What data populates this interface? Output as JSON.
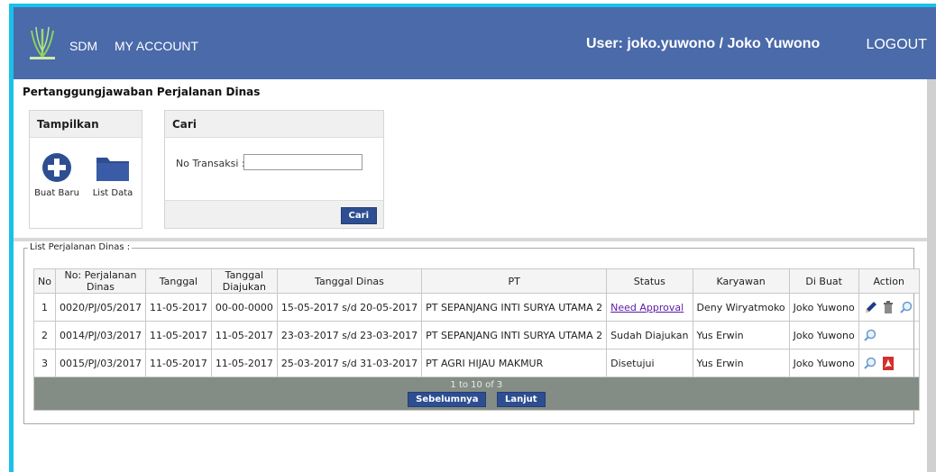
{
  "nav": {
    "app_name": "SDM",
    "account_label": "MY ACCOUNT",
    "user_label": "User: joko.yuwono / Joko Yuwono",
    "logout_label": "LOGOUT",
    "bar_color": "#4a6aa9"
  },
  "page_title": "Pertanggungjawaban Perjalanan Dinas",
  "tampilkan": {
    "title": "Tampilkan",
    "new_label": "Buat Baru",
    "list_label": "List Data",
    "icons": [
      "plus-circle-icon",
      "folder-icon"
    ]
  },
  "search": {
    "title": "Cari",
    "field_label": "No Transaksi :",
    "field_value": "",
    "button_label": "Cari"
  },
  "list": {
    "legend": "List Perjalanan Dinas :",
    "columns": [
      "No",
      "No: Perjalanan Dinas",
      "Tanggal",
      "Tanggal Diajukan",
      "Tanggal Dinas",
      "PT",
      "Status",
      "Karyawan",
      "Di Buat",
      "Action"
    ],
    "rows": [
      {
        "no": "1",
        "id": "0020/PJ/05/2017",
        "tanggal": "11-05-2017",
        "diajukan": "00-00-0000",
        "dinas": "15-05-2017 s/d 20-05-2017",
        "pt": "PT SEPANJANG INTI SURYA UTAMA 2",
        "status": "Need Approval",
        "karyawan": "Deny Wiryatmoko",
        "dibuat": "Joko Yuwono",
        "actions": [
          "edit-pencil-icon",
          "delete-trash-icon",
          "view-magnifier-icon"
        ]
      },
      {
        "no": "2",
        "id": "0014/PJ/03/2017",
        "tanggal": "11-05-2017",
        "diajukan": "11-05-2017",
        "dinas": "23-03-2017 s/d 23-03-2017",
        "pt": "PT SEPANJANG INTI SURYA UTAMA 2",
        "status": "Sudah Diajukan",
        "karyawan": "Yus Erwin",
        "dibuat": "Joko Yuwono",
        "actions": [
          "view-magnifier-icon"
        ]
      },
      {
        "no": "3",
        "id": "0015/PJ/03/2017",
        "tanggal": "11-05-2017",
        "diajukan": "11-05-2017",
        "dinas": "25-03-2017 s/d 31-03-2017",
        "pt": "PT AGRI HIJAU MAKMUR",
        "status": "Disetujui",
        "karyawan": "Yus Erwin",
        "dibuat": "Joko Yuwono",
        "actions": [
          "view-magnifier-icon",
          "pdf-icon"
        ]
      }
    ],
    "pager_text": "1 to 10 of 3",
    "prev_label": "Sebelumnya",
    "next_label": "Lanjut"
  }
}
